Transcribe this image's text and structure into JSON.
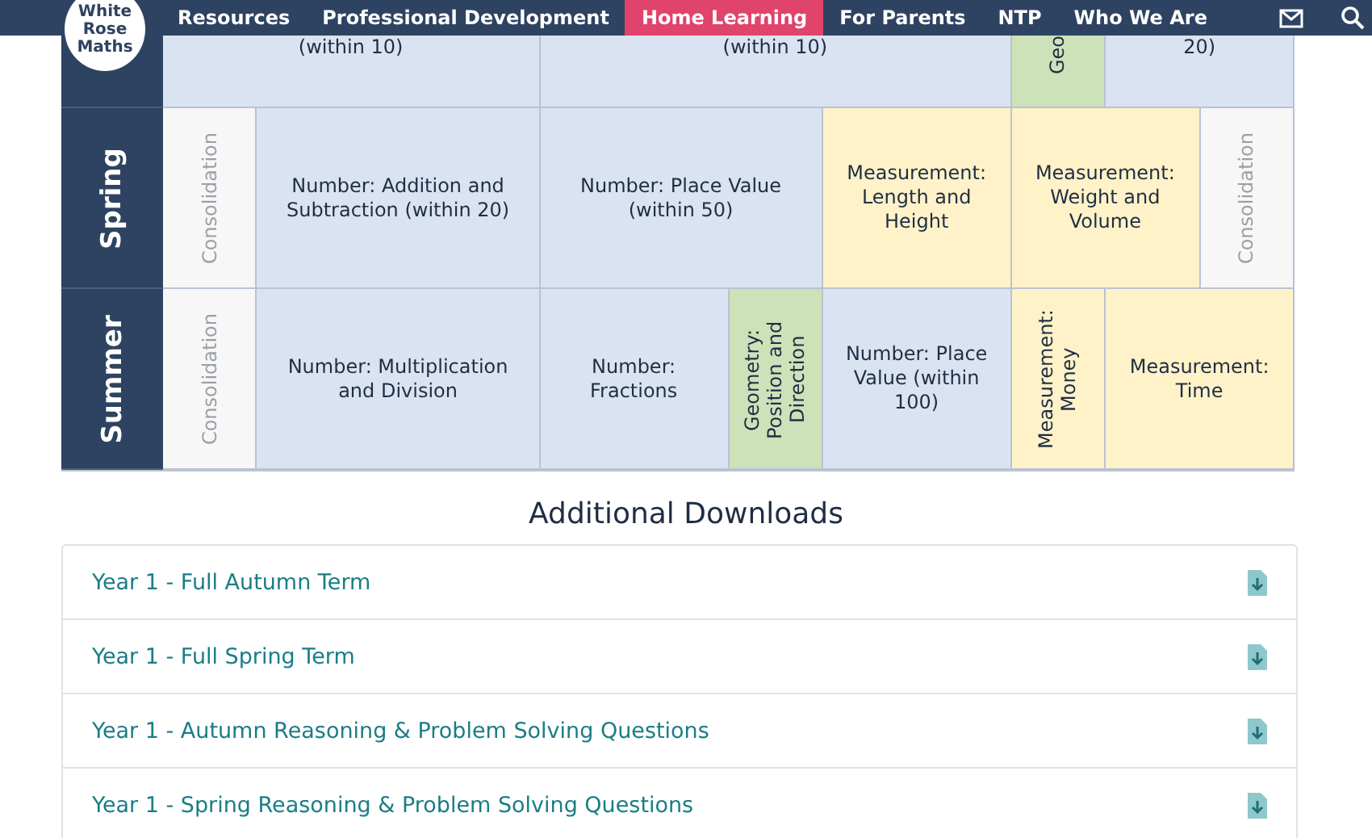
{
  "nav": {
    "logo": [
      "White",
      "Rose",
      "Maths"
    ],
    "items": [
      {
        "label": "Resources",
        "selected": false
      },
      {
        "label": "Professional Development",
        "selected": false
      },
      {
        "label": "Home Learning",
        "selected": true
      },
      {
        "label": "For Parents",
        "selected": false
      },
      {
        "label": "NTP",
        "selected": false
      },
      {
        "label": "Who We Are",
        "selected": false
      }
    ]
  },
  "scheme": {
    "cut_row": {
      "cells": [
        {
          "text": "(within 10)",
          "kind": "number",
          "vertical": false,
          "colspan": 4
        },
        {
          "text": "(within 10)",
          "kind": "number",
          "vertical": false,
          "colspan": 5
        },
        {
          "text": "Geo",
          "kind": "geometry",
          "vertical": true
        },
        {
          "text": "20)",
          "kind": "number",
          "vertical": false,
          "colspan": 2
        }
      ]
    },
    "rows": [
      {
        "season": "Spring",
        "cells": [
          {
            "text": "Consolidation",
            "kind": "consolidation",
            "vertical": true
          },
          {
            "text": "Number: Addition and Subtraction (within 20)",
            "kind": "number",
            "vertical": false,
            "colspan": 3
          },
          {
            "text": "Number: Place Value (within 50)",
            "kind": "number",
            "vertical": false,
            "colspan": 3
          },
          {
            "text": "Measurement: Length and Height",
            "kind": "measurement",
            "vertical": false,
            "colspan": 2
          },
          {
            "text": "Measurement: Weight and Volume",
            "kind": "measurement",
            "vertical": false,
            "colspan": 2
          },
          {
            "text": "Consolidation",
            "kind": "consolidation",
            "vertical": true
          }
        ]
      },
      {
        "season": "Summer",
        "cells": [
          {
            "text": "Consolidation",
            "kind": "consolidation",
            "vertical": true
          },
          {
            "text": "Number: Multiplication and Division",
            "kind": "number",
            "vertical": false,
            "colspan": 3
          },
          {
            "text": "Number: Fractions",
            "kind": "number",
            "vertical": false,
            "colspan": 2
          },
          {
            "text": "Geometry: Position and Direction",
            "kind": "geometry",
            "vertical": true
          },
          {
            "text": "Number: Place Value (within 100)",
            "kind": "number",
            "vertical": false,
            "colspan": 2
          },
          {
            "text": "Measurement: Money",
            "kind": "measurement",
            "vertical": true
          },
          {
            "text": "Measurement: Time",
            "kind": "measurement",
            "vertical": false,
            "colspan": 2
          }
        ]
      }
    ]
  },
  "downloads": {
    "title": "Additional Downloads",
    "items": [
      "Year 1 - Full Autumn Term",
      "Year 1 - Full Spring Term",
      "Year 1 - Autumn Reasoning & Problem Solving Questions",
      "Year 1 - Spring Reasoning & Problem Solving Questions"
    ]
  }
}
